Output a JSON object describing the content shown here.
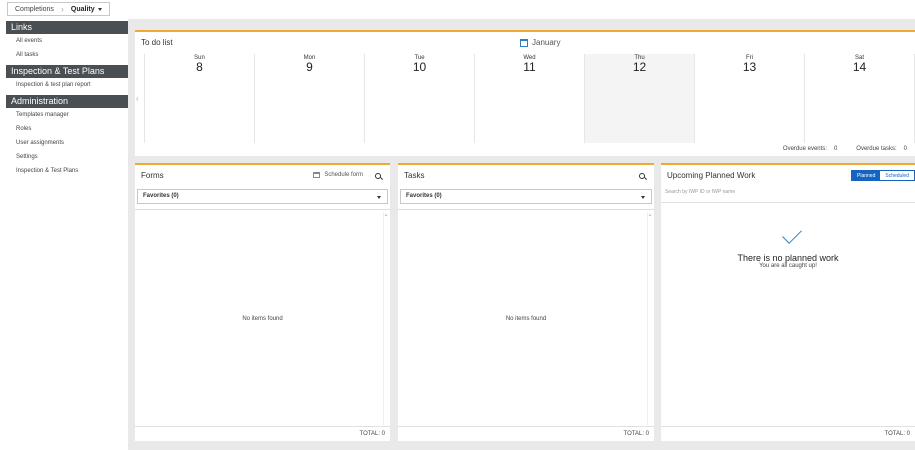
{
  "breadcrumb": {
    "items": [
      "Completions",
      "Quality"
    ]
  },
  "sidebar": {
    "sections": [
      {
        "title": "Links",
        "items": [
          "All events",
          "All tasks"
        ]
      },
      {
        "title": "Inspection & Test Plans",
        "items": [
          "Inspection & test plan report"
        ]
      },
      {
        "title": "Administration",
        "items": [
          "Templates manager",
          "Roles",
          "User assignments",
          "Settings",
          "Inspection & Test Plans"
        ]
      }
    ]
  },
  "todo": {
    "title": "To do list",
    "month": "January",
    "days": [
      {
        "name": "Sun",
        "num": "8"
      },
      {
        "name": "Mon",
        "num": "9"
      },
      {
        "name": "Tue",
        "num": "10"
      },
      {
        "name": "Wed",
        "num": "11"
      },
      {
        "name": "Thu",
        "num": "12"
      },
      {
        "name": "Fri",
        "num": "13"
      },
      {
        "name": "Sat",
        "num": "14"
      }
    ],
    "overdue_events_label": "Overdue events:",
    "overdue_events_value": "0",
    "overdue_tasks_label": "Overdue tasks:",
    "overdue_tasks_value": "0"
  },
  "forms": {
    "title": "Forms",
    "schedule_label": "Schedule form",
    "favorites": "Favorites (0)",
    "empty": "No items found",
    "total": "TOTAL: 0"
  },
  "tasks": {
    "title": "Tasks",
    "favorites": "Favorites (0)",
    "empty": "No items found",
    "total": "TOTAL: 0"
  },
  "planned": {
    "title": "Upcoming Planned Work",
    "toggle_on": "Planned",
    "toggle_off": "Scheduled",
    "search_placeholder": "Search by IWP ID or IWP name",
    "empty_title": "There is no planned work",
    "empty_sub": "You are all caught up!",
    "total": "TOTAL: 0"
  },
  "colors": {
    "accent": "#f0a830",
    "primary": "#1565c0",
    "sidebar_head": "#4a4f53"
  }
}
